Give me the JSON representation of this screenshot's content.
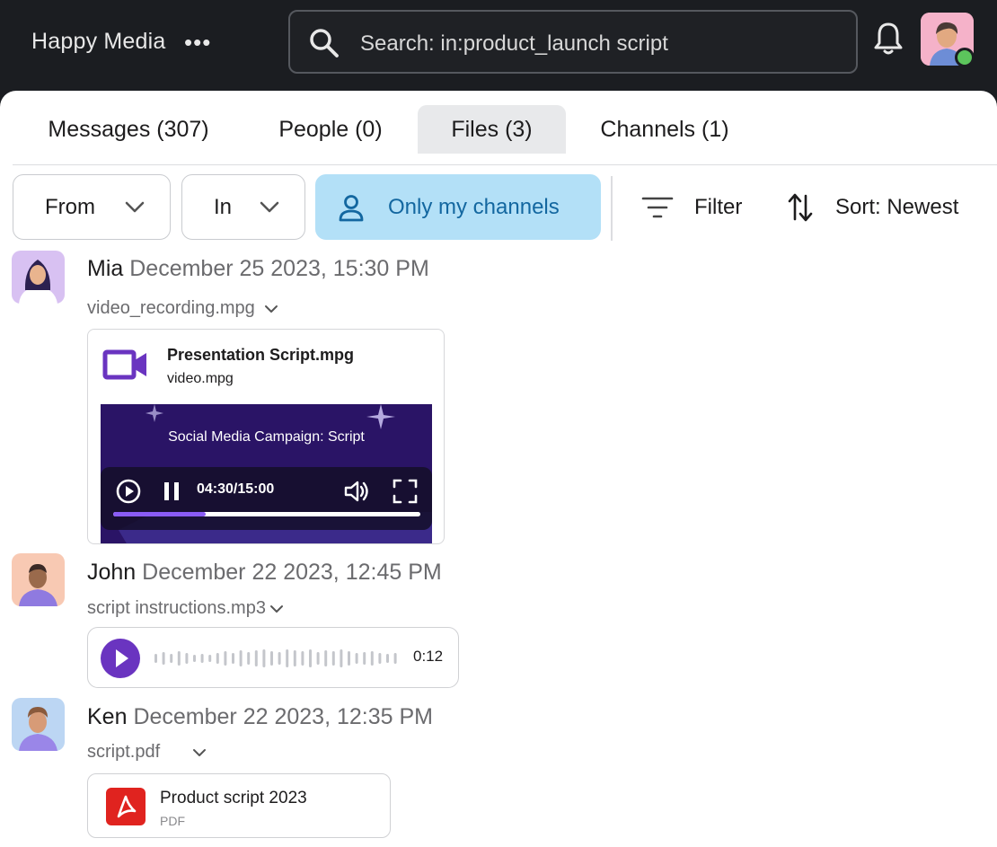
{
  "app": {
    "workspace_name": "Happy Media",
    "more_label": "•••",
    "search_text": "Search: in:product_launch script"
  },
  "tabs": [
    {
      "label": "Messages (307)",
      "active": false
    },
    {
      "label": "People (0)",
      "active": false
    },
    {
      "label": "Files (3)",
      "active": true
    },
    {
      "label": "Channels (1)",
      "active": false
    }
  ],
  "filters": {
    "from_label": "From",
    "in_label": "In",
    "only_my_channels_label": "Only my channels",
    "filter_label": "Filter",
    "sort_label": "Sort: Newest"
  },
  "results": [
    {
      "name": "Mia",
      "date": "December 25 2023, 15:30 PM",
      "file_name": "video_recording.mpg",
      "attachment": {
        "title": "Presentation Script.mpg",
        "subtitle": "video.mpg",
        "thumbnail_title": "Social Media Campaign: Script",
        "time": "04:30/15:00",
        "progress": 0.3
      }
    },
    {
      "name": "John",
      "date": "December 22 2023, 12:45 PM",
      "file_name": "script instructions.mp3",
      "attachment": {
        "duration": "0:12"
      }
    },
    {
      "name": "Ken",
      "date": "December 22 2023, 12:35 PM",
      "file_name": "script.pdf",
      "attachment": {
        "title": "Product script 2023",
        "subtitle": "PDF"
      }
    }
  ],
  "colors": {
    "topbar": "#1b1d21",
    "active_filter_bg": "#b3e0f7",
    "active_filter_text": "#1367a0",
    "video_icon": "#6a34c0",
    "audio_play": "#6a34c0",
    "pdf_icon": "#e0231f",
    "presence": "#5cc55c"
  }
}
